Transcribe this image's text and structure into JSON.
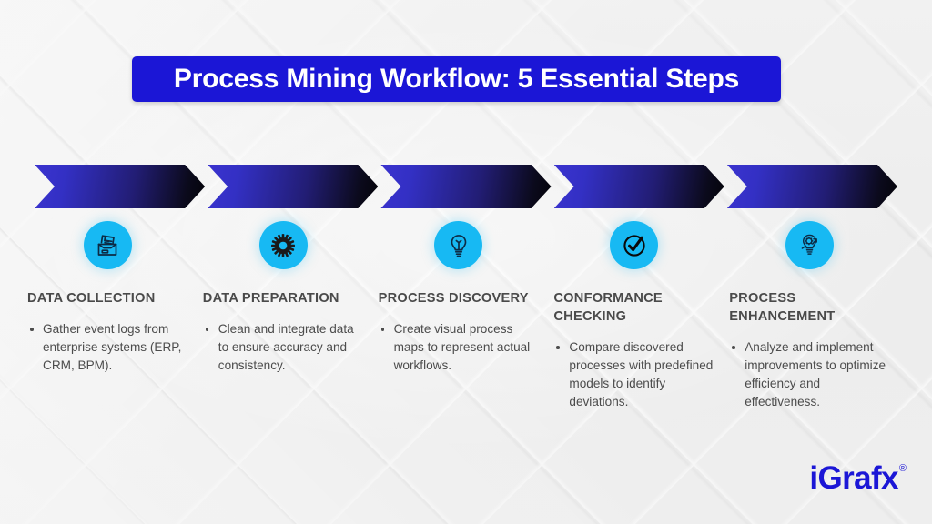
{
  "title": {
    "text": "Process Mining Workflow: 5 Essential Steps",
    "background_color": "#1b16d6",
    "text_color": "#ffffff"
  },
  "theme": {
    "chevron_start_color": "#3b33cf",
    "chevron_end_color": "#040409",
    "icon_circle_color": "#17b9f3",
    "icon_line_color": "#0d2b45",
    "heading_color": "#4a4a4a",
    "body_color": "#4c4c4c",
    "background_color": "#eeeeee"
  },
  "steps": [
    {
      "icon": "documents-archive-icon",
      "heading": "DATA COLLECTION",
      "bullet": "Gather event logs from enterprise systems (ERP, CRM, BPM)."
    },
    {
      "icon": "gear-icon",
      "heading": "DATA PREPARATION",
      "bullet": "Clean and integrate data to ensure accuracy and consistency."
    },
    {
      "icon": "lightbulb-icon",
      "heading": "PROCESS DISCOVERY",
      "bullet": "Create visual process maps to represent actual workflows."
    },
    {
      "icon": "check-circle-icon",
      "heading": "CONFORMANCE CHECKING",
      "bullet": "Compare discovered processes with predefined models to identify deviations."
    },
    {
      "icon": "lightbulb-gear-growth-icon",
      "heading": "PROCESS ENHANCEMENT",
      "bullet": "Analyze and implement improvements to optimize efficiency and effectiveness."
    }
  ],
  "logo": {
    "text": "iGrafx",
    "trademark": "®",
    "color": "#1b16d6"
  }
}
